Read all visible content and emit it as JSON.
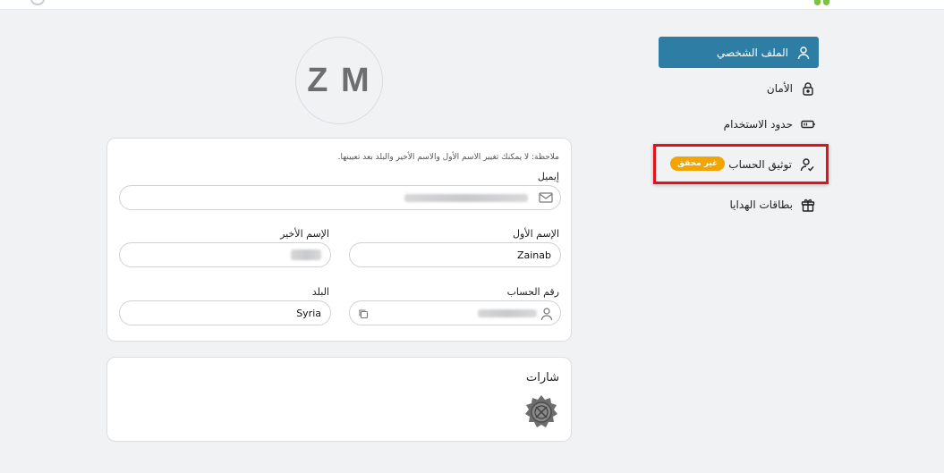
{
  "avatar": {
    "initials": "Z M"
  },
  "sidebar": {
    "items": [
      {
        "label": "الملف الشخصي",
        "icon": "user-icon",
        "active": true
      },
      {
        "label": "الأمان",
        "icon": "lock-icon"
      },
      {
        "label": "حدود الاستخدام",
        "icon": "battery-icon"
      },
      {
        "label": "توثيق الحساب",
        "icon": "user-check-icon",
        "badge": "غير محقق"
      },
      {
        "label": "بطاقات الهدايا",
        "icon": "gift-icon"
      }
    ]
  },
  "profile": {
    "note": "ملاحظة: لا يمكنك تغيير الاسم الأول والاسم الأخير والبلد بعد تعيينها.",
    "email_label": "إيميل",
    "first_name_label": "الإسم الأول",
    "first_name_value": "Zainab",
    "last_name_label": "الإسم الأخير",
    "account_number_label": "رقم الحساب",
    "country_label": "البلد",
    "country_value": "Syria"
  },
  "badges": {
    "title": "شارات",
    "icon": "badge-medal-icon"
  },
  "colors": {
    "accent": "#2d7da5",
    "badge_warning": "#f2a400",
    "highlight": "#e0121b",
    "logo_green": "#7cc242"
  }
}
